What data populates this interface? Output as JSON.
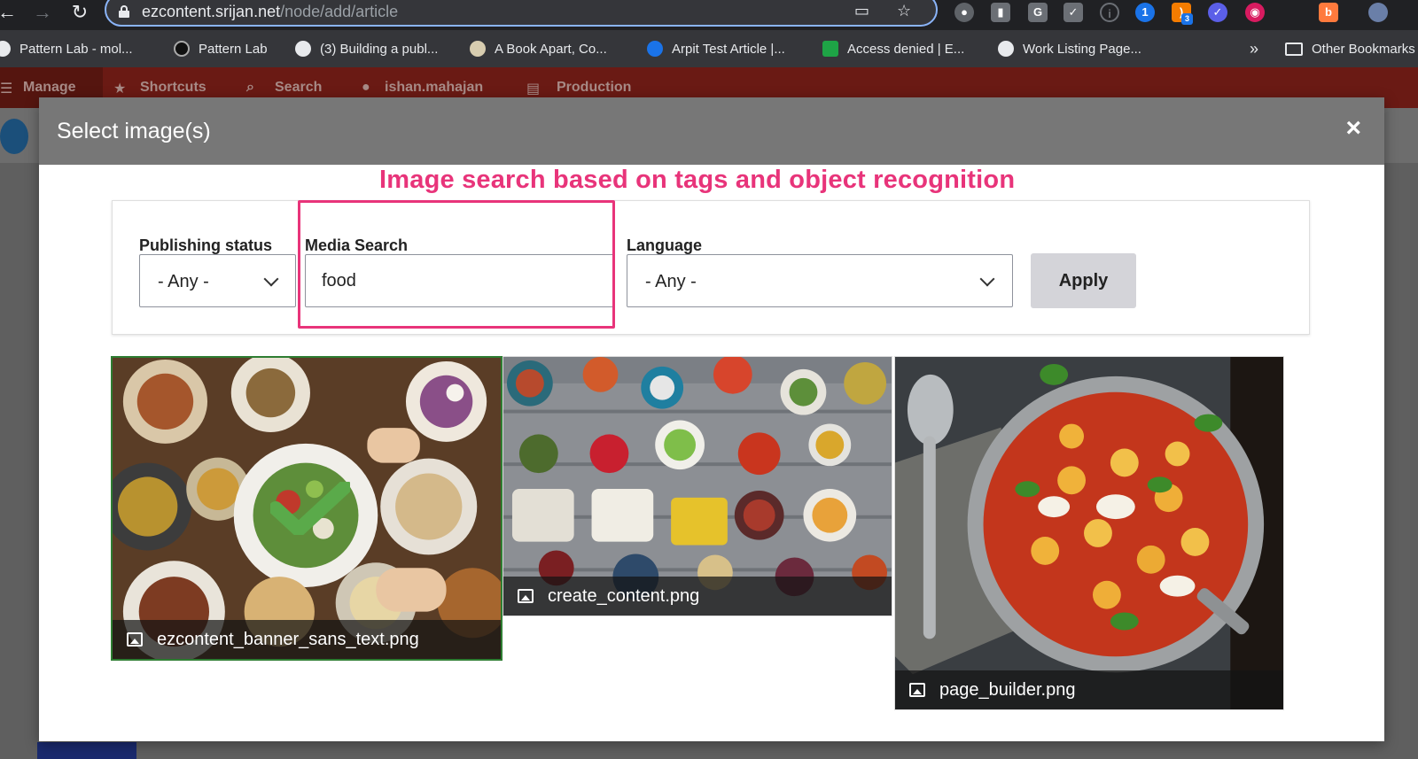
{
  "browser": {
    "url_host": "ezcontent.srijan.net",
    "url_path": "/node/add/article",
    "bookmarks": [
      {
        "label": "Pattern Lab - mol..."
      },
      {
        "label": "Pattern Lab"
      },
      {
        "label": "(3) Building a publ..."
      },
      {
        "label": "A Book Apart, Co..."
      },
      {
        "label": "Arpit Test Article |..."
      },
      {
        "label": "Access denied | E..."
      },
      {
        "label": "Work Listing Page..."
      }
    ],
    "overflow_label": "»",
    "other_bookmarks_label": "Other Bookmarks",
    "extension_badge": "3"
  },
  "toolbar": {
    "manage": "Manage",
    "shortcuts": "Shortcuts",
    "search": "Search",
    "user": "ishan.mahajan",
    "production": "Production"
  },
  "modal": {
    "title": "Select image(s)",
    "close": "×",
    "annotation": "Image search based on tags and object recognition",
    "filters": {
      "publishing_status": {
        "label": "Publishing status",
        "value": "- Any -"
      },
      "media_search": {
        "label": "Media Search",
        "value": "food"
      },
      "language": {
        "label": "Language",
        "value": "- Any -"
      },
      "apply": "Apply"
    },
    "media": [
      {
        "name": "ezcontent_banner_sans_text.png",
        "selected": true
      },
      {
        "name": "create_content.png",
        "selected": false
      },
      {
        "name": "page_builder.png",
        "selected": false
      }
    ]
  }
}
